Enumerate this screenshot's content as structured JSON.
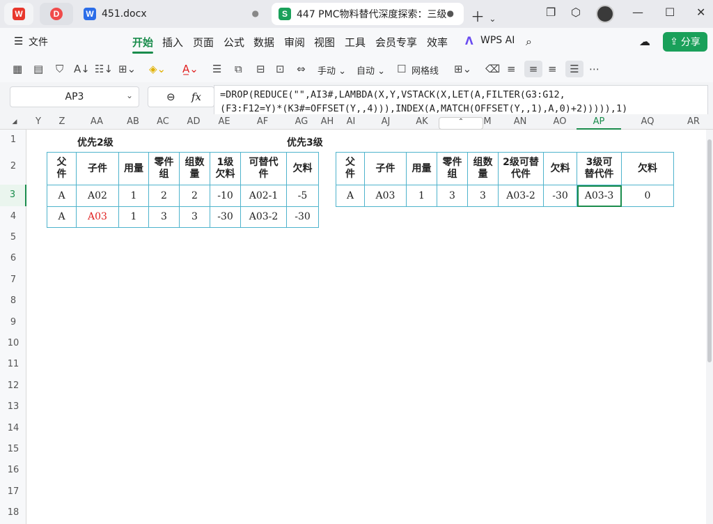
{
  "titlebar": {
    "tabs": [
      {
        "label": ""
      },
      {
        "label": ""
      },
      {
        "label": "451.docx"
      },
      {
        "label": "447 PMC物料替代深度探索：三级"
      }
    ]
  },
  "menu": {
    "file": "文件",
    "items": [
      "开始",
      "插入",
      "页面",
      "公式",
      "数据",
      "审阅",
      "视图",
      "工具",
      "会员专享",
      "效率"
    ],
    "wps_ai": "WPS AI",
    "share": "分享"
  },
  "toolbar": {
    "manual": "手动",
    "auto": "自动",
    "gridlines": "网格线"
  },
  "formulabar": {
    "name_box": "AP3",
    "fx": "fx",
    "formula": "=DROP(REDUCE(\"\",AI3#,LAMBDA(X,Y,VSTACK(X,LET(A,FILTER(G3:G12,\n(F3:F12=Y)*(K3#=OFFSET(Y,,4))),INDEX(A,MATCH(OFFSET(Y,,1),A,0)+2))))),1)"
  },
  "columns": [
    "Y",
    "Z",
    "AA",
    "AB",
    "AC",
    "AD",
    "AE",
    "AF",
    "AG",
    "AH",
    "AI",
    "AJ",
    "AK",
    "M",
    "AN",
    "AO",
    "AP",
    "AQ",
    "AR"
  ],
  "rows": [
    "1",
    "2",
    "3",
    "4",
    "5",
    "6",
    "7",
    "8",
    "9",
    "10",
    "11",
    "12",
    "13",
    "14",
    "15",
    "16",
    "17",
    "18"
  ],
  "sheet": {
    "label1": "优先2级",
    "label2": "优先3级",
    "table1": {
      "headers": [
        "父件",
        "子件",
        "用量",
        "零件组",
        "组数量",
        "1级欠料",
        "可替代件",
        "欠料"
      ],
      "rows": [
        [
          "A",
          "A02",
          "1",
          "2",
          "2",
          "-10",
          "A02-1",
          "-5"
        ],
        [
          "A",
          "A03",
          "1",
          "3",
          "3",
          "-30",
          "A03-2",
          "-30"
        ]
      ]
    },
    "table2": {
      "headers": [
        "父件",
        "子件",
        "用量",
        "零件组",
        "组数量",
        "2级可替代件",
        "欠料",
        "3级可替代件",
        "欠料"
      ],
      "rows": [
        [
          "A",
          "A03",
          "1",
          "3",
          "3",
          "A03-2",
          "-30",
          "A03-3",
          "0"
        ]
      ]
    }
  },
  "colors": {
    "accent": "#1a8c4c",
    "table_border": "#4eb3cc",
    "highlight_text": "#e02020"
  }
}
